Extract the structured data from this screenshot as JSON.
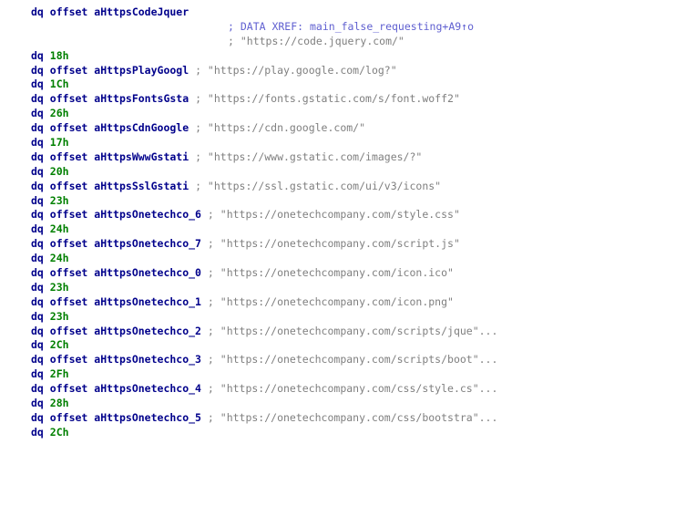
{
  "listing": {
    "header": {
      "mnemonic": "dq",
      "keyword": "offset",
      "operand": "aHttpsCodeJquer",
      "xref_comment": "; DATA XREF: main_false_requesting+A9↑o",
      "string_comment": "; \"https://code.jquery.com/\""
    },
    "rows": [
      {
        "kind": "num",
        "mnemonic": "dq",
        "value": "18h"
      },
      {
        "kind": "off",
        "mnemonic": "dq",
        "keyword": "offset",
        "operand": "aHttpsPlayGoogl",
        "comment": "; \"https://play.google.com/log?\""
      },
      {
        "kind": "num",
        "mnemonic": "dq",
        "value": "1Ch"
      },
      {
        "kind": "off",
        "mnemonic": "dq",
        "keyword": "offset",
        "operand": "aHttpsFontsGsta",
        "comment": "; \"https://fonts.gstatic.com/s/font.woff2\""
      },
      {
        "kind": "num",
        "mnemonic": "dq",
        "value": "26h"
      },
      {
        "kind": "off",
        "mnemonic": "dq",
        "keyword": "offset",
        "operand": "aHttpsCdnGoogle",
        "comment": "; \"https://cdn.google.com/\""
      },
      {
        "kind": "num",
        "mnemonic": "dq",
        "value": "17h"
      },
      {
        "kind": "off",
        "mnemonic": "dq",
        "keyword": "offset",
        "operand": "aHttpsWwwGstati",
        "comment": "; \"https://www.gstatic.com/images/?\""
      },
      {
        "kind": "num",
        "mnemonic": "dq",
        "value": "20h"
      },
      {
        "kind": "off",
        "mnemonic": "dq",
        "keyword": "offset",
        "operand": "aHttpsSslGstati",
        "comment": "; \"https://ssl.gstatic.com/ui/v3/icons\""
      },
      {
        "kind": "num",
        "mnemonic": "dq",
        "value": "23h"
      },
      {
        "kind": "off",
        "mnemonic": "dq",
        "keyword": "offset",
        "operand": "aHttpsOnetechco_6",
        "comment": "; \"https://onetechcompany.com/style.css\""
      },
      {
        "kind": "num",
        "mnemonic": "dq",
        "value": "24h"
      },
      {
        "kind": "off",
        "mnemonic": "dq",
        "keyword": "offset",
        "operand": "aHttpsOnetechco_7",
        "comment": "; \"https://onetechcompany.com/script.js\""
      },
      {
        "kind": "num",
        "mnemonic": "dq",
        "value": "24h"
      },
      {
        "kind": "off",
        "mnemonic": "dq",
        "keyword": "offset",
        "operand": "aHttpsOnetechco_0",
        "comment": "; \"https://onetechcompany.com/icon.ico\""
      },
      {
        "kind": "num",
        "mnemonic": "dq",
        "value": "23h"
      },
      {
        "kind": "off",
        "mnemonic": "dq",
        "keyword": "offset",
        "operand": "aHttpsOnetechco_1",
        "comment": "; \"https://onetechcompany.com/icon.png\""
      },
      {
        "kind": "num",
        "mnemonic": "dq",
        "value": "23h"
      },
      {
        "kind": "off",
        "mnemonic": "dq",
        "keyword": "offset",
        "operand": "aHttpsOnetechco_2",
        "comment": "; \"https://onetechcompany.com/scripts/jque\"..."
      },
      {
        "kind": "num",
        "mnemonic": "dq",
        "value": "2Ch"
      },
      {
        "kind": "off",
        "mnemonic": "dq",
        "keyword": "offset",
        "operand": "aHttpsOnetechco_3",
        "comment": "; \"https://onetechcompany.com/scripts/boot\"..."
      },
      {
        "kind": "num",
        "mnemonic": "dq",
        "value": "2Fh"
      },
      {
        "kind": "off",
        "mnemonic": "dq",
        "keyword": "offset",
        "operand": "aHttpsOnetechco_4",
        "comment": "; \"https://onetechcompany.com/css/style.cs\"..."
      },
      {
        "kind": "num",
        "mnemonic": "dq",
        "value": "28h"
      },
      {
        "kind": "off",
        "mnemonic": "dq",
        "keyword": "offset",
        "operand": "aHttpsOnetechco_5",
        "comment": "; \"https://onetechcompany.com/css/bootstra\"..."
      },
      {
        "kind": "num",
        "mnemonic": "dq",
        "value": "2Ch"
      }
    ]
  },
  "colors": {
    "mnemonic": "#00008b",
    "number": "#008000",
    "comment": "#7f7f7f",
    "xref": "#5f5fd0",
    "background": "#ffffff"
  }
}
